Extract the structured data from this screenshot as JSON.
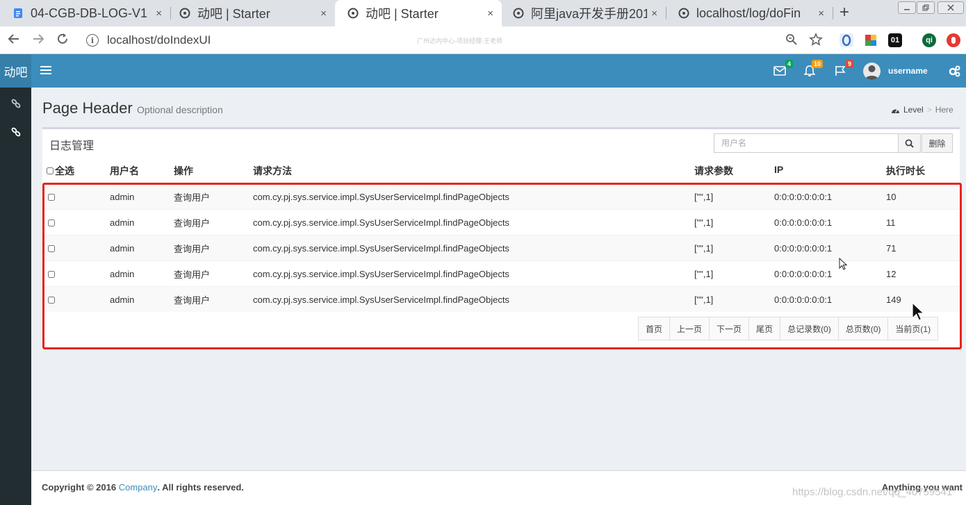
{
  "browser": {
    "tabs": [
      {
        "title": "04-CGB-DB-LOG-V1",
        "icon": "document-icon",
        "active": false
      },
      {
        "title": "动吧 | Starter",
        "icon": "globe-icon",
        "active": false
      },
      {
        "title": "动吧 | Starter",
        "icon": "globe-icon",
        "active": true
      },
      {
        "title": "阿里java开发手册201",
        "icon": "globe-icon",
        "active": false
      },
      {
        "title": "localhost/log/doFin",
        "icon": "globe-icon",
        "active": false
      }
    ],
    "close_symbol": "×",
    "new_tab_symbol": "+",
    "url": "localhost/doIndexUI",
    "top_watermark": "广州达内中心-项目经理-王老师",
    "extensions": [
      "01",
      "qi"
    ]
  },
  "app": {
    "logo": "动吧",
    "notifications": {
      "mail": "4",
      "bell": "10",
      "flag": "9"
    },
    "user": {
      "name": "username"
    }
  },
  "page": {
    "title": "Page Header",
    "description": "Optional description",
    "breadcrumb": {
      "level": "Level",
      "separator": ">",
      "here": "Here"
    }
  },
  "log_box": {
    "title": "日志管理",
    "search_placeholder": "用户名",
    "delete_label": "删除",
    "columns": [
      "全选",
      "用户名",
      "操作",
      "请求方法",
      "请求参数",
      "IP",
      "执行时长"
    ],
    "rows": [
      {
        "username": "admin",
        "operation": "查询用户",
        "method": "com.cy.pj.sys.service.impl.SysUserServiceImpl.findPageObjects",
        "params": "[\"\",1]",
        "ip": "0:0:0:0:0:0:0:1",
        "time": "10"
      },
      {
        "username": "admin",
        "operation": "查询用户",
        "method": "com.cy.pj.sys.service.impl.SysUserServiceImpl.findPageObjects",
        "params": "[\"\",1]",
        "ip": "0:0:0:0:0:0:0:1",
        "time": "11"
      },
      {
        "username": "admin",
        "operation": "查询用户",
        "method": "com.cy.pj.sys.service.impl.SysUserServiceImpl.findPageObjects",
        "params": "[\"\",1]",
        "ip": "0:0:0:0:0:0:0:1",
        "time": "71"
      },
      {
        "username": "admin",
        "operation": "查询用户",
        "method": "com.cy.pj.sys.service.impl.SysUserServiceImpl.findPageObjects",
        "params": "[\"\",1]",
        "ip": "0:0:0:0:0:0:0:1",
        "time": "12"
      },
      {
        "username": "admin",
        "operation": "查询用户",
        "method": "com.cy.pj.sys.service.impl.SysUserServiceImpl.findPageObjects",
        "params": "[\"\",1]",
        "ip": "0:0:0:0:0:0:0:1",
        "time": "149"
      }
    ],
    "pagination": [
      "首页",
      "上一页",
      "下一页",
      "尾页",
      "总记录数(0)",
      "总页数(0)",
      "当前页(1)"
    ]
  },
  "footer": {
    "copyright_prefix": "Copyright © 2016 ",
    "company": "Company",
    "copyright_suffix": ". All rights reserved.",
    "right_text": "Anything you want",
    "watermark": "https://blog.csdn.net/qq_40759541"
  },
  "colors": {
    "header": "#3c8dbc",
    "logo_bg": "#367fa9",
    "sidebar": "#222d32",
    "highlight": "#e8241b",
    "badge_green": "#00a65a",
    "badge_yellow": "#f39c12",
    "badge_red": "#dd4b39"
  }
}
